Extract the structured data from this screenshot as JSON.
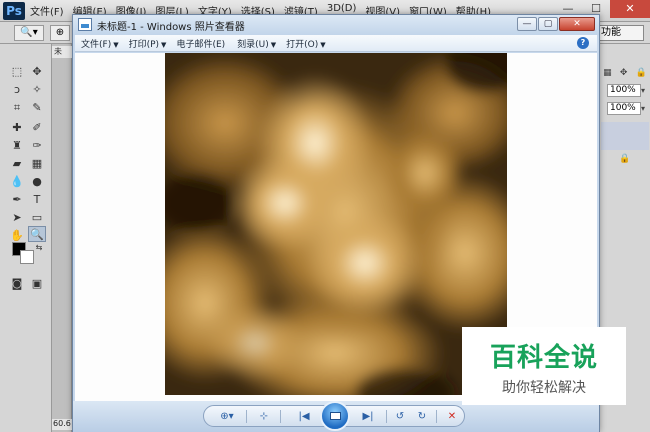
{
  "photoshop": {
    "logo": "Ps",
    "menu": [
      "文件(F)",
      "编辑(E)",
      "图像(I)",
      "图层(L)",
      "文字(Y)",
      "选择(S)",
      "滤镜(T)",
      "3D(D)",
      "视图(V)",
      "窗口(W)",
      "帮助(H)"
    ],
    "window_controls": [
      "—",
      "☐",
      "✕"
    ],
    "workspace_value": "功能",
    "doc_tab": "未",
    "zoom_status": "60.6",
    "opacity_value": "100%",
    "fill_value": "100%"
  },
  "viewer": {
    "title": "未标题-1 - Windows 照片查看器",
    "menu": [
      {
        "label": "文件(F)",
        "caret": "▼"
      },
      {
        "label": "打印(P)",
        "caret": "▼"
      },
      {
        "label": "电子邮件(E)",
        "caret": ""
      },
      {
        "label": "刻录(U)",
        "caret": "▼"
      },
      {
        "label": "打开(O)",
        "caret": "▼"
      }
    ],
    "help_icon": "?",
    "caption_buttons": {
      "minimize": "—",
      "maximize": "▢",
      "close": "✕"
    },
    "controls": {
      "zoom": "⊕▾",
      "fit": "⊹",
      "previous": "|◀",
      "next": "▶|",
      "rotate_ccw": "↺",
      "rotate_cw": "↻",
      "delete": "✕"
    }
  },
  "watermark": {
    "title": "百科全说",
    "subtitle": "助你轻松解决"
  },
  "colors": {
    "accent_green": "#18a25a",
    "photo_gold": "#c79a4e",
    "photo_dark": "#2a1c08"
  }
}
